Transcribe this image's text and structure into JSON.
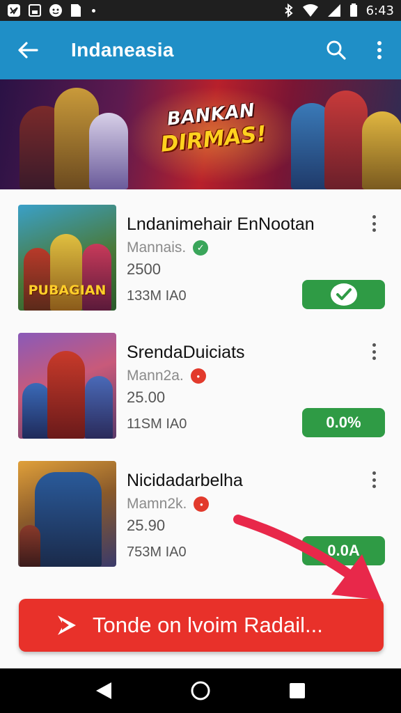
{
  "status_bar": {
    "time": "6:43",
    "icons": [
      "app-icon",
      "gallery-icon",
      "messenger-icon",
      "file-icon",
      "notification-dot",
      "bluetooth-icon",
      "wifi-icon",
      "signal-icon",
      "battery-icon"
    ]
  },
  "app_bar": {
    "title": "Indaneasia",
    "back_icon": "arrow-left-icon",
    "search_icon": "search-icon",
    "menu_icon": "more-vertical-icon",
    "color": "#1f8fc7"
  },
  "banner": {
    "line1": "BANKAN",
    "line2": "DIRMAS!"
  },
  "games": [
    {
      "title": "Lndanimehair EnNootan",
      "developer": "Mannais.",
      "badge": "✓",
      "badge_color": "#3aa55a",
      "rating": "2500",
      "size": "133M IA0",
      "action": "",
      "action_icon": "check-icon",
      "thumb_text": "PUBAGIAN"
    },
    {
      "title": "SrendaDuiciats",
      "developer": "Mann2a.",
      "badge": "•",
      "badge_color": "#e23a2c",
      "rating": "25.00",
      "size": "11SM IA0",
      "action": "0.0%",
      "thumb_text": ""
    },
    {
      "title": "Nicidadarbelha",
      "developer": "Mamn2k.",
      "badge": "•",
      "badge_color": "#e23a2c",
      "rating": "25.90",
      "size": "753M IA0",
      "action": "0.0A",
      "thumb_text": ""
    }
  ],
  "cta": {
    "label": "Tonde on lvoim Radail...",
    "icon": "play-icon",
    "color": "#e8312a"
  },
  "nav_bar": {
    "back": "back-triangle-icon",
    "home": "home-circle-icon",
    "recents": "recents-square-icon"
  }
}
